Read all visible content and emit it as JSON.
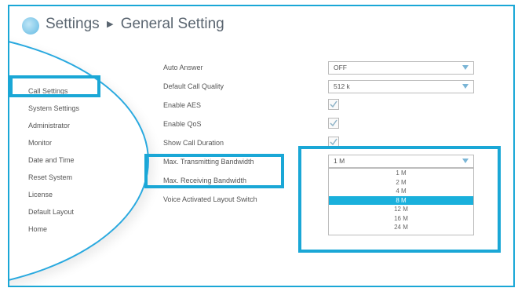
{
  "header": {
    "app_title": "Settings",
    "separator_icon": "triangle-right",
    "section_title": "General Setting"
  },
  "sidebar": {
    "items": [
      {
        "label": "Call Settings",
        "selected": true
      },
      {
        "label": "System Settings"
      },
      {
        "label": "Administrator"
      },
      {
        "label": "Monitor"
      },
      {
        "label": "Date and Time"
      },
      {
        "label": "Reset System"
      },
      {
        "label": "License"
      },
      {
        "label": "Default Layout"
      },
      {
        "label": "Home"
      }
    ]
  },
  "settings": {
    "auto_answer": {
      "label": "Auto Answer",
      "value": "OFF"
    },
    "default_call_quality": {
      "label": "Default Call Quality",
      "value": "512 k"
    },
    "enable_aes": {
      "label": "Enable AES",
      "checked": true
    },
    "enable_qos": {
      "label": "Enable QoS",
      "checked": true
    },
    "show_call_duration": {
      "label": "Show Call Duration",
      "checked": true
    },
    "max_tx_bandwidth": {
      "label": "Max. Transmitting Bandwidth",
      "value": "1 M"
    },
    "max_rx_bandwidth": {
      "label": "Max. Receiving Bandwidth"
    },
    "voice_activated_layout_switch": {
      "label": "Voice Activated Layout Switch"
    }
  },
  "bandwidth_dropdown": {
    "options": [
      "1 M",
      "2 M",
      "4 M",
      "8 M",
      "12 M",
      "16 M",
      "24 M"
    ],
    "highlighted": "8 M"
  },
  "colors": {
    "accent": "#1aa7d6",
    "highlight": "#1ab0dc"
  }
}
